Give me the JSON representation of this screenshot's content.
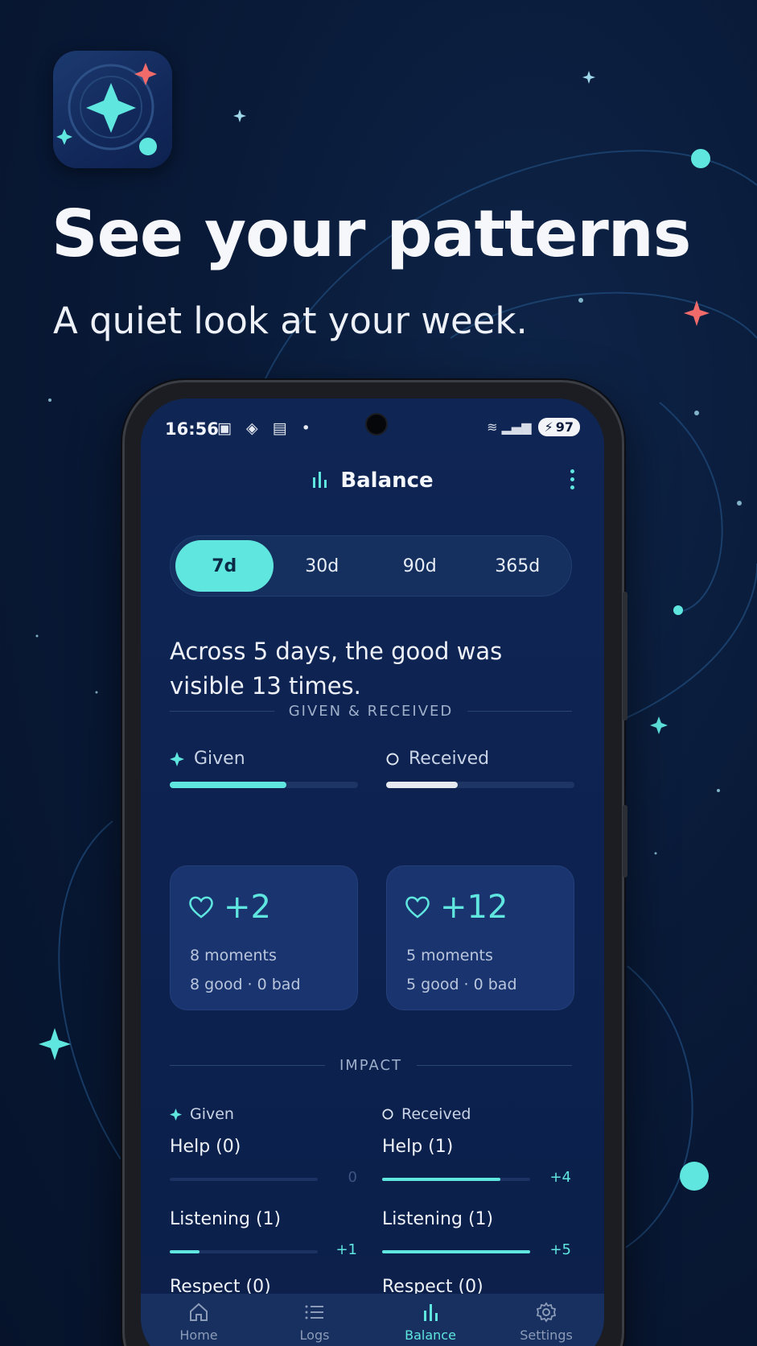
{
  "promo": {
    "headline": "See your patterns",
    "subheadline": "A quiet look at your week."
  },
  "status_bar": {
    "time": "16:56",
    "battery": "97"
  },
  "top_bar": {
    "title": "Balance",
    "title_icon": "bar-chart-icon",
    "more_icon": "more-vert-icon"
  },
  "range_tabs": [
    {
      "label": "7d",
      "active": true
    },
    {
      "label": "30d",
      "active": false
    },
    {
      "label": "90d",
      "active": false
    },
    {
      "label": "365d",
      "active": false
    }
  ],
  "summary": "Across 5 days, the good was visible 13 times.",
  "given_received": {
    "section_title": "GIVEN & RECEIVED",
    "given": {
      "label": "Given",
      "icon": "sparkle-icon",
      "bar_fraction": 0.62,
      "score": "+2",
      "moments": "8 moments",
      "breakdown": "8 good · 0 bad"
    },
    "received": {
      "label": "Received",
      "icon": "circle-icon",
      "bar_fraction": 0.38,
      "score": "+12",
      "moments": "5 moments",
      "breakdown": "5 good · 0 bad"
    }
  },
  "impact": {
    "section_title": "IMPACT",
    "given_label": "Given",
    "received_label": "Received",
    "given": [
      {
        "name": "Help (0)",
        "fraction": 0.0,
        "value": "0"
      },
      {
        "name": "Listening (1)",
        "fraction": 0.2,
        "value": "+1"
      },
      {
        "name": "Respect (0)",
        "fraction": 0.0,
        "value": ""
      }
    ],
    "received": [
      {
        "name": "Help (1)",
        "fraction": 0.8,
        "value": "+4"
      },
      {
        "name": "Listening (1)",
        "fraction": 1.0,
        "value": "+5"
      },
      {
        "name": "Respect (0)",
        "fraction": 0.0,
        "value": ""
      }
    ]
  },
  "nav": [
    {
      "label": "Home",
      "icon": "home-icon",
      "active": false
    },
    {
      "label": "Logs",
      "icon": "list-icon",
      "active": false
    },
    {
      "label": "Balance",
      "icon": "bar-chart-icon",
      "active": true
    },
    {
      "label": "Settings",
      "icon": "gear-icon",
      "active": false
    }
  ],
  "colors": {
    "accent": "#5fe6df",
    "star_red": "#f26b6b",
    "received_bar": "#e6e9ef"
  }
}
